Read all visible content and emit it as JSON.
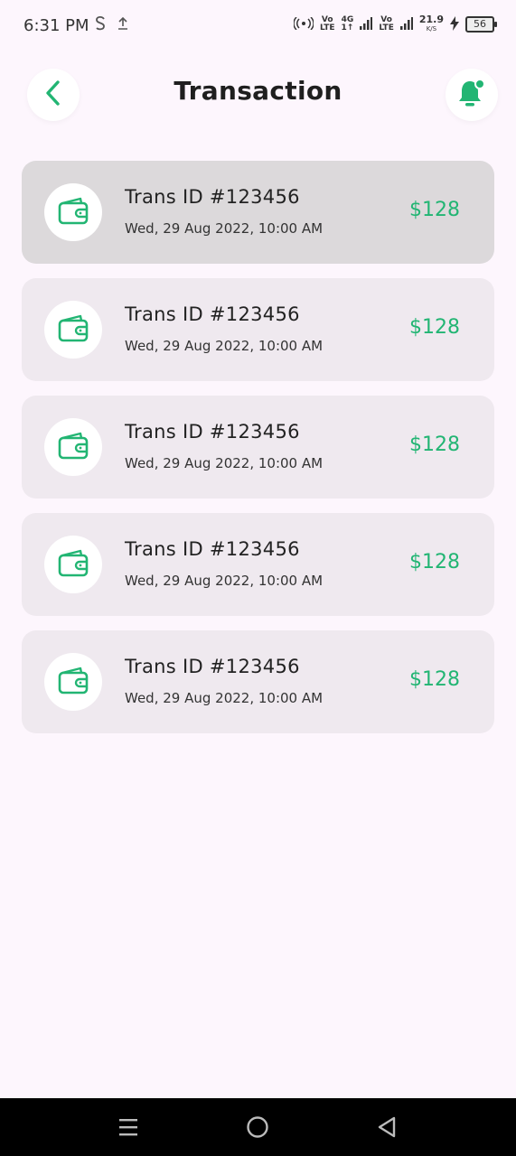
{
  "status_bar": {
    "time": "6:31 PM",
    "vo_lte_1_top": "Vo",
    "vo_lte_1_bottom": "LTE",
    "network_4g_top": "4G",
    "network_4g_bottom": "1↑",
    "vo_lte_2_top": "Vo",
    "vo_lte_2_bottom": "LTE",
    "speed_value": "21.9",
    "speed_unit": "K/S",
    "battery": "56"
  },
  "header": {
    "title": "Transaction",
    "back_icon": "chevron-left-icon",
    "notification_icon": "bell-icon"
  },
  "colors": {
    "accent": "#22b573",
    "background": "#fdf6fd",
    "card": "#efe9ef",
    "card_selected": "#dcd9db"
  },
  "transactions": [
    {
      "title": "Trans ID #123456",
      "date": "Wed, 29 Aug 2022, 10:00 AM",
      "amount": "$128",
      "icon": "wallet-icon",
      "selected": true
    },
    {
      "title": "Trans ID #123456",
      "date": "Wed, 29 Aug 2022, 10:00 AM",
      "amount": "$128",
      "icon": "wallet-icon",
      "selected": false
    },
    {
      "title": "Trans ID #123456",
      "date": "Wed, 29 Aug 2022, 10:00 AM",
      "amount": "$128",
      "icon": "wallet-icon",
      "selected": false
    },
    {
      "title": "Trans ID #123456",
      "date": "Wed, 29 Aug 2022, 10:00 AM",
      "amount": "$128",
      "icon": "wallet-icon",
      "selected": false
    },
    {
      "title": "Trans ID #123456",
      "date": "Wed, 29 Aug 2022, 10:00 AM",
      "amount": "$128",
      "icon": "wallet-icon",
      "selected": false
    }
  ],
  "nav_bar": {
    "items": [
      "menu-icon",
      "home-icon",
      "back-triangle-icon"
    ]
  }
}
